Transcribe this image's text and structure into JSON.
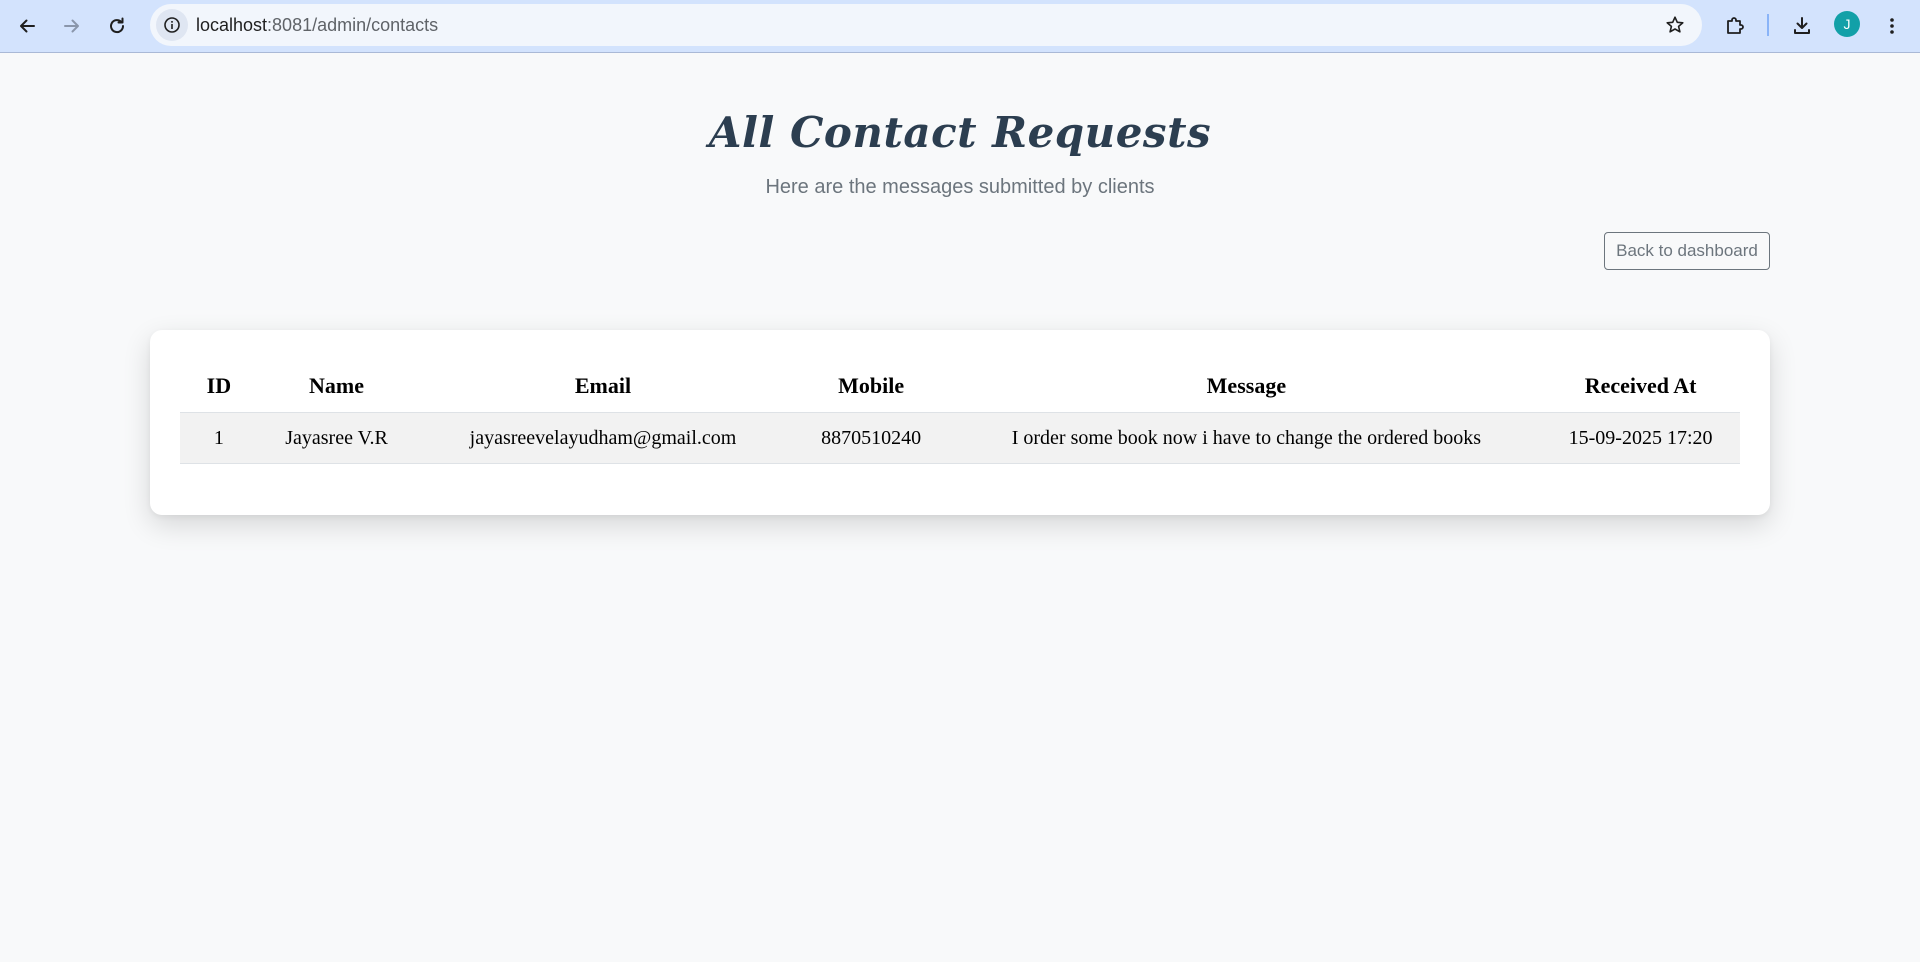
{
  "browser": {
    "url_host": "localhost",
    "url_path": ":8081/admin/contacts",
    "avatar_letter": "J"
  },
  "page": {
    "title": "All Contact Requests",
    "subtitle": "Here are the messages submitted by clients",
    "back_button_label": "Back to dashboard"
  },
  "table": {
    "headers": {
      "id": "ID",
      "name": "Name",
      "email": "Email",
      "mobile": "Mobile",
      "message": "Message",
      "received_at": "Received At"
    },
    "rows": [
      {
        "id": "1",
        "name": "Jayasree V.R",
        "email": "jayasreevelayudham@gmail.com",
        "mobile": "8870510240",
        "message": "I order some book now i have to change the ordered books",
        "received_at": "15-09-2025 17:20"
      }
    ]
  },
  "colors": {
    "chrome_bg": "#d3e3fd",
    "page_bg": "#f8f9fa",
    "title": "#2c3e50",
    "muted": "#6c757d",
    "avatar": "#12a0a8"
  },
  "icons": {
    "back": "arrow-left-icon",
    "forward": "arrow-right-icon",
    "reload": "reload-icon",
    "site_info": "info-icon",
    "bookmark": "star-icon",
    "extensions": "puzzle-icon",
    "downloads": "download-icon",
    "menu": "more-vert-icon"
  }
}
